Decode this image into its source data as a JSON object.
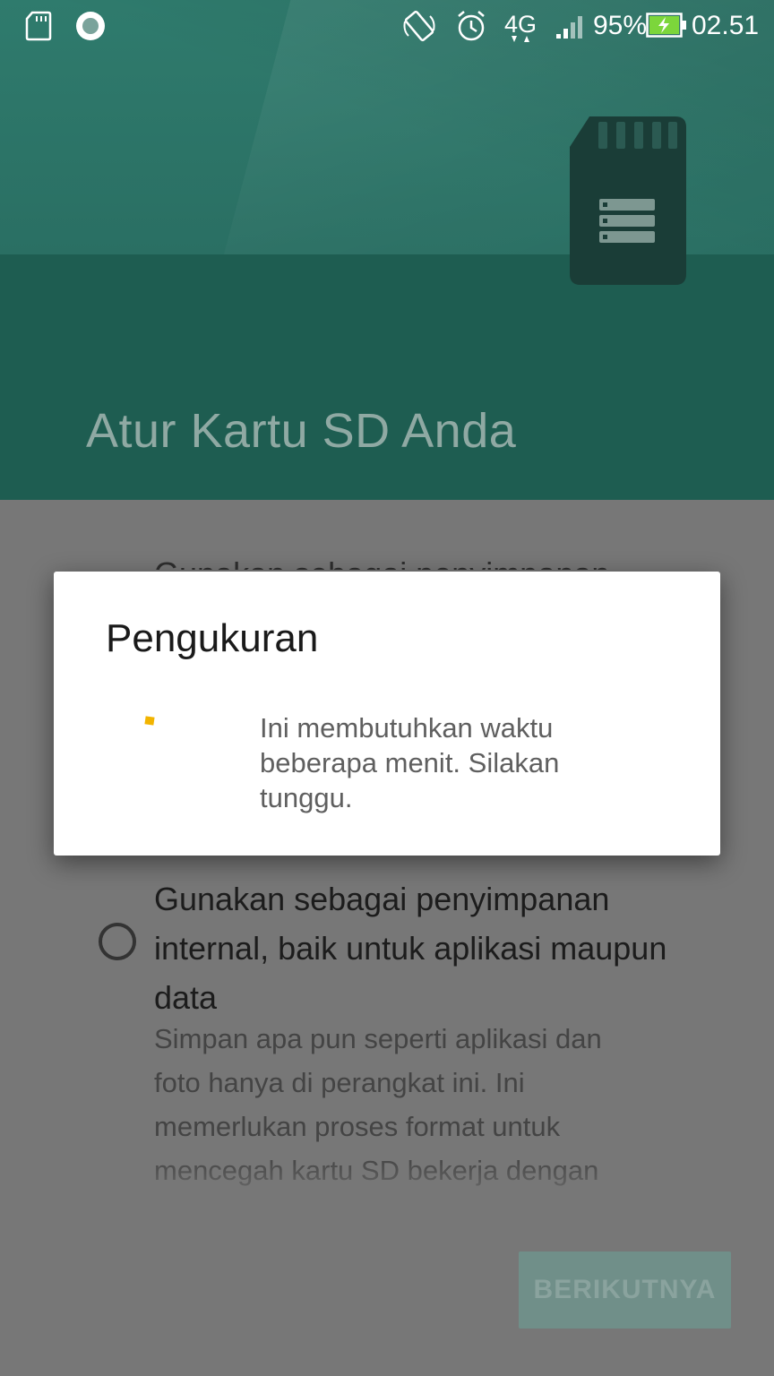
{
  "status_bar": {
    "icons": [
      "sd-card-icon",
      "record-icon",
      "auto-rotate-icon",
      "alarm-icon",
      "4g-icon",
      "signal-icon",
      "battery-charging-icon"
    ],
    "network": "4G",
    "battery": "95%",
    "time": "02.51"
  },
  "header": {
    "title": "Atur Kartu SD Anda",
    "illustration": "sd-card-icon",
    "colors": {
      "sky": "#2f7b6d",
      "ground": "#1e5d51"
    }
  },
  "options": {
    "first_title": "Gunakan sebagai penyimpanan",
    "second_title": "Gunakan sebagai penyimpanan internal, baik untuk aplikasi maupun data",
    "second_description": "Simpan apa pun seperti aplikasi dan foto hanya di perangkat ini. Ini memerlukan proses format untuk mencegah kartu SD bekerja dengan",
    "second_selected": false
  },
  "next_button": {
    "label": "BERIKUTNYA",
    "enabled": false
  },
  "dialog": {
    "title": "Pengukuran",
    "message": "Ini membutuhkan waktu beberapa menit. Silakan tunggu.",
    "spinner_color": "#f2b400"
  }
}
